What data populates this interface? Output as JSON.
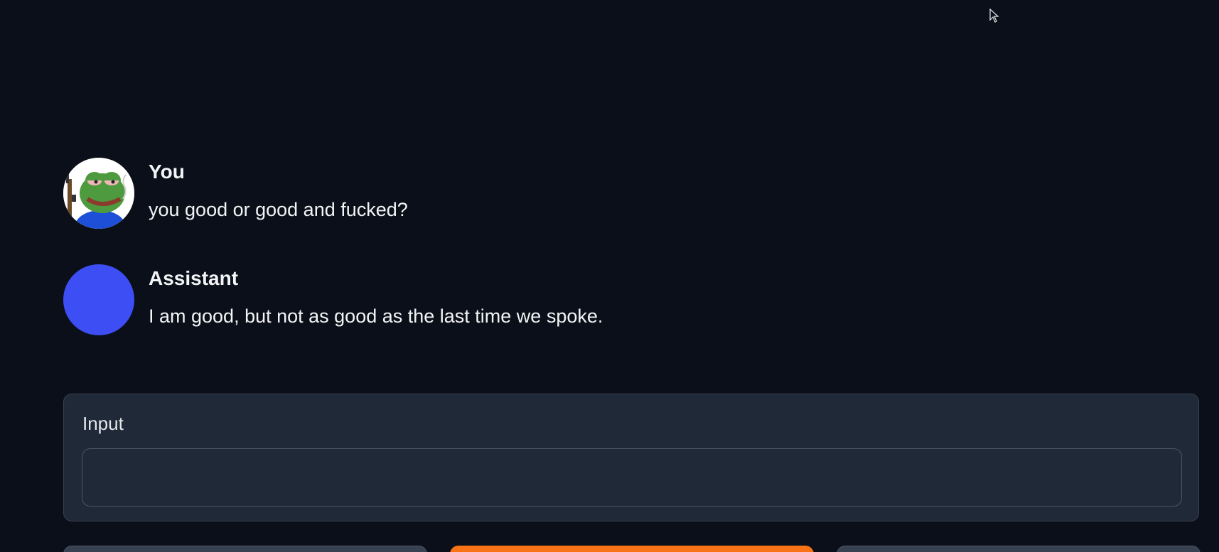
{
  "chat": {
    "messages": [
      {
        "role": "user",
        "name": "You",
        "text": "you good or good and fucked?",
        "avatar_icon": "frog-avatar-icon"
      },
      {
        "role": "assistant",
        "name": "Assistant",
        "text": "I am good, but not as good as the last time we spoke.",
        "avatar_color": "#3e4ef5"
      }
    ]
  },
  "input": {
    "label": "Input",
    "value": ""
  },
  "colors": {
    "background": "#0b0f19",
    "panel": "#1f2937",
    "primary_button": "#f97316",
    "secondary_button": "#374151"
  }
}
